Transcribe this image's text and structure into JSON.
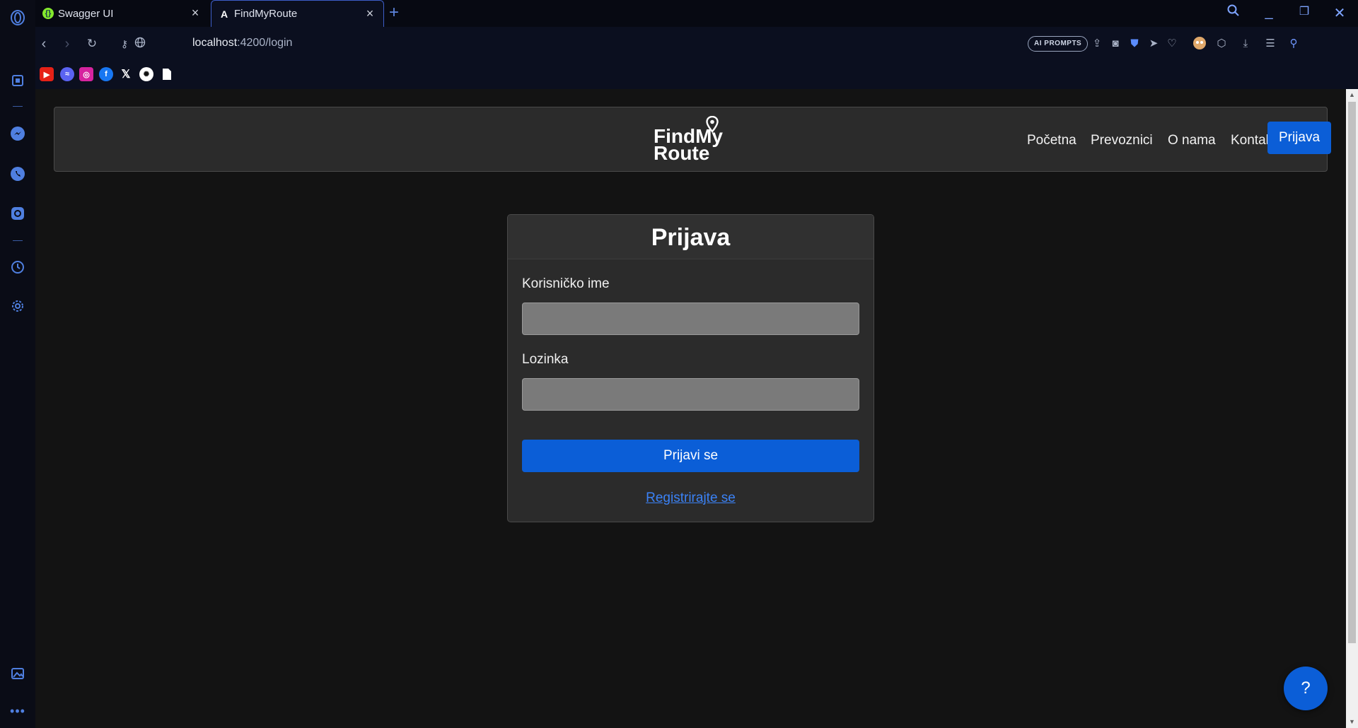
{
  "browser": {
    "tabs": [
      {
        "title": "Swagger UI",
        "favicon": "swagger-icon"
      },
      {
        "title": "FindMyRoute",
        "favicon": "angular-icon"
      }
    ],
    "url_host": "localhost",
    "url_path": ":4200/login",
    "ai_prompts_label": "AI PROMPTS",
    "accent_color": "#4f7fe0"
  },
  "site": {
    "logo_line1": "FindMy",
    "logo_line2": "Route",
    "nav": {
      "home": "Početna",
      "carriers": "Prevoznici",
      "about": "O nama",
      "contact": "Kontakt",
      "login": "Prijava"
    },
    "primary_color": "#0b5ed7"
  },
  "login_form": {
    "title": "Prijava",
    "username_label": "Korisničko ime",
    "username_value": "",
    "password_label": "Lozinka",
    "password_value": "",
    "submit_label": "Prijavi se",
    "register_link": "Registrirajte se"
  },
  "help_button": "?"
}
